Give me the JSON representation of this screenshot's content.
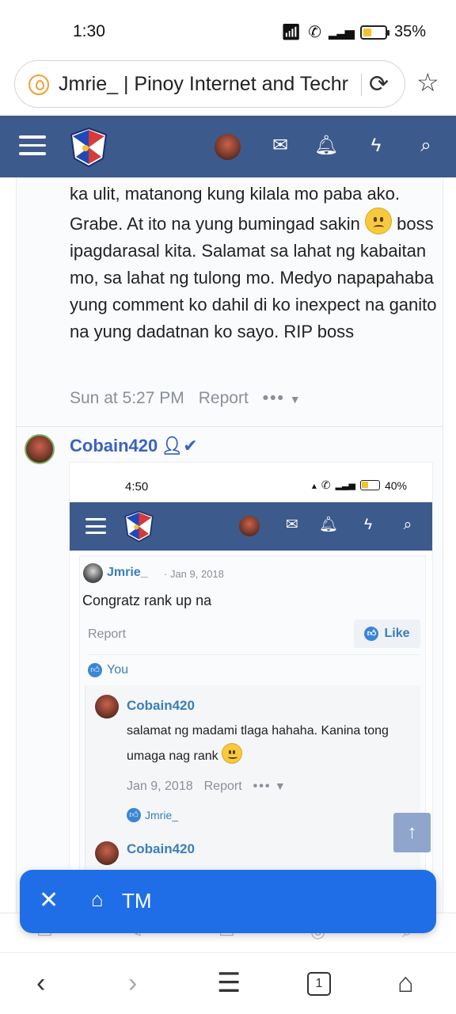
{
  "status": {
    "time": "1:30",
    "battery": "35%",
    "battery_level": 0.35
  },
  "browser": {
    "tab_title": "Jmrie_ | Pinoy Internet and Techr",
    "tabs_count": "1"
  },
  "post": {
    "text": "ka ulit, matanong kung kilala mo paba ako. Grabe. At ito na yung bumingad sakin",
    "text2": "boss ipagdarasal kita. Salamat sa lahat ng kabaitan mo, sa lahat ng tulong mo. Medyo napapahaba yung comment ko dahil di ko inexpect na ganito na yung dadatnan ko sayo. RIP boss",
    "time": "Sun at 5:27 PM",
    "report": "Report",
    "more": "•••"
  },
  "reply": {
    "author": "Cobain420"
  },
  "screenshot": {
    "time": "4:50",
    "battery": "40%",
    "battery_level": 0.4,
    "msg_author": "Jmrie_",
    "msg_date": "· Jan 9, 2018",
    "msg_text": "Congratz rank up na",
    "report": "Report",
    "like": "Like",
    "you": "You",
    "reply_author": "Cobain420",
    "reply_text": "salamat ng madami tlaga hahaha. Kanina tong umaga nag rank",
    "reply_date": "Jan 9, 2018",
    "reply_report": "Report",
    "more": "•••",
    "liker": "Jmrie_",
    "next_author": "Cobain420"
  },
  "tagbar": {
    "label": "TM"
  },
  "colors": {
    "header": "#3d5a8c",
    "link": "#3a62c0",
    "tagbar": "#1f6ee8"
  }
}
